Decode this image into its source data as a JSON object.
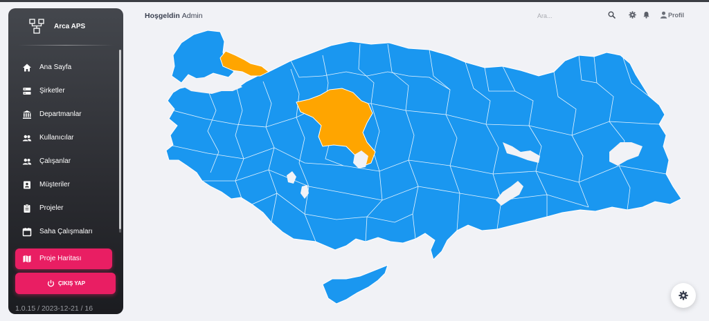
{
  "brand": {
    "name": "Arca APS",
    "logo_icon": "org-chart-icon"
  },
  "nav": [
    {
      "label": "Ana Sayfa",
      "icon": "home-icon",
      "active": false
    },
    {
      "label": "Şirketler",
      "icon": "server-icon",
      "active": false
    },
    {
      "label": "Departmanlar",
      "icon": "bank-icon",
      "active": false
    },
    {
      "label": "Kullanıcılar",
      "icon": "users-icon",
      "active": false
    },
    {
      "label": "Çalışanlar",
      "icon": "users-icon",
      "active": false
    },
    {
      "label": "Müşteriler",
      "icon": "contact-icon",
      "active": false
    },
    {
      "label": "Projeler",
      "icon": "clipboard-icon",
      "active": false
    },
    {
      "label": "Saha Çalışmaları",
      "icon": "calendar-icon",
      "active": false
    },
    {
      "label": "Proje Haritası",
      "icon": "map-icon",
      "active": true
    }
  ],
  "logout": {
    "label": "ÇIKIŞ YAP",
    "icon": "power-icon"
  },
  "version": "1.0.15 / 2023-12-21 / 16",
  "header": {
    "greeting": "Hoşgeldin",
    "user": "Admin"
  },
  "search": {
    "placeholder": "Ara...",
    "value": ""
  },
  "profile": {
    "label": "Profil"
  },
  "colors": {
    "accent": "#e91e63",
    "map_default": "#1a97f0",
    "map_highlight": "#ffa500",
    "map_border": "#ffffff"
  },
  "map": {
    "highlighted_provinces": [
      "İstanbul",
      "Ankara"
    ]
  }
}
